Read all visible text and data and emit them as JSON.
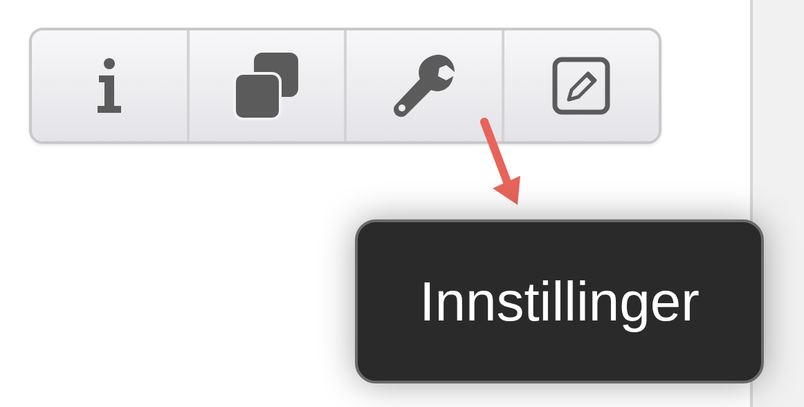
{
  "toolbar": {
    "buttons": [
      {
        "kind": "info"
      },
      {
        "kind": "copy"
      },
      {
        "kind": "settings"
      },
      {
        "kind": "edit"
      }
    ]
  },
  "tooltip": {
    "text": "Innstillinger"
  }
}
